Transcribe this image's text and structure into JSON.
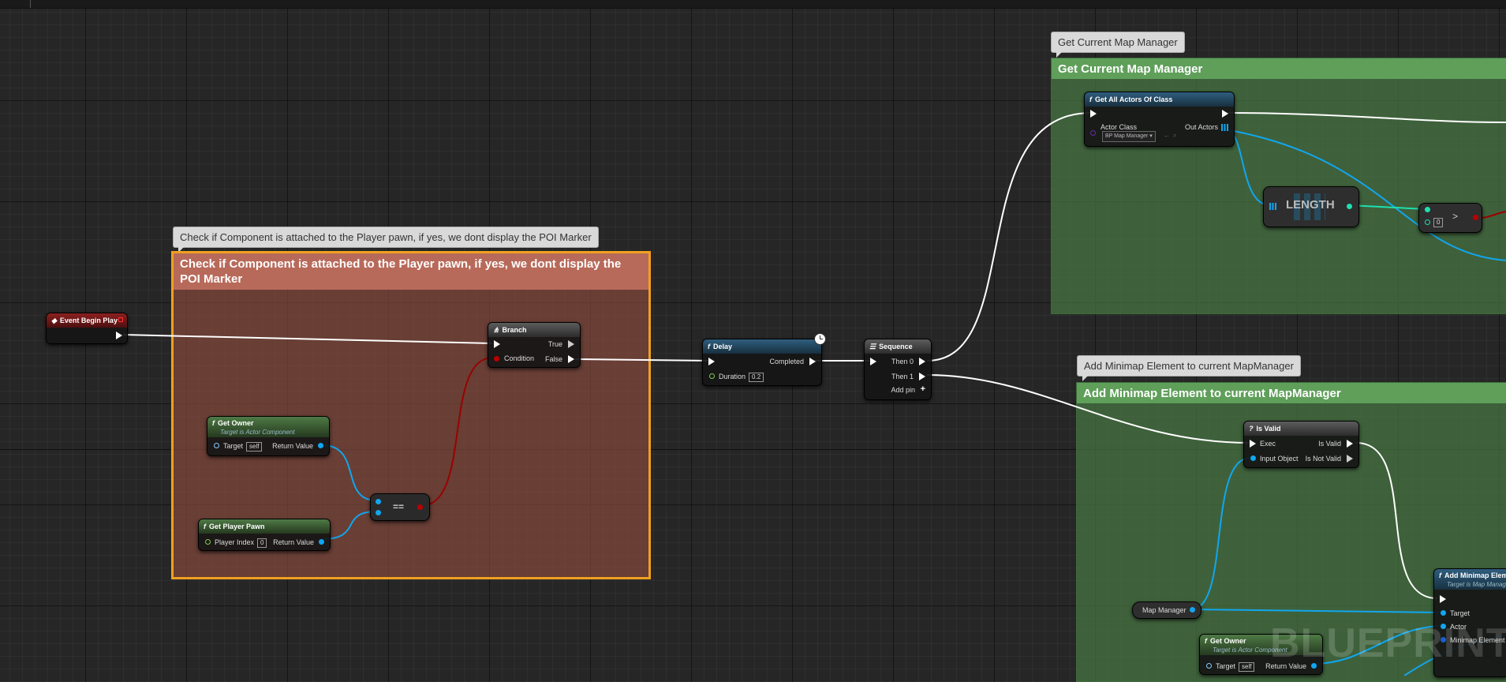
{
  "comments": {
    "check_component": {
      "bubble": "Check if Component is attached to the Player pawn, if yes, we dont display the POI Marker",
      "header": "Check if Component is attached to the Player pawn, if yes, we dont display the POI Marker",
      "color": "#b86a5a"
    },
    "get_map_manager": {
      "bubble": "Get Current Map Manager",
      "header": "Get Current Map Manager",
      "color": "#5f9f5a"
    },
    "add_minimap": {
      "bubble": "Add Minimap Element to current MapManager",
      "header": "Add Minimap Element to current MapManager",
      "color": "#5f9f5a"
    }
  },
  "nodes": {
    "event_begin_play": {
      "title": "Event Begin Play"
    },
    "branch": {
      "title": "Branch",
      "pins": {
        "condition": "Condition",
        "true": "True",
        "false": "False"
      }
    },
    "get_owner_1": {
      "title": "Get Owner",
      "subtitle": "Target is Actor Component",
      "pins": {
        "target": "Target",
        "target_value": "self",
        "return": "Return Value"
      }
    },
    "get_player_pawn": {
      "title": "Get Player Pawn",
      "pins": {
        "player_index": "Player Index",
        "player_index_value": "0",
        "return": "Return Value"
      }
    },
    "equals": {
      "title": "=="
    },
    "delay": {
      "title": "Delay",
      "pins": {
        "completed": "Completed",
        "duration": "Duration",
        "duration_value": "0.2"
      }
    },
    "sequence": {
      "title": "Sequence",
      "pins": {
        "then0": "Then 0",
        "then1": "Then 1",
        "add_pin": "Add pin"
      }
    },
    "get_all_actors": {
      "title": "Get All Actors Of Class",
      "pins": {
        "actor_class": "Actor Class",
        "actor_class_value": "BP Map Manager",
        "out_actors": "Out Actors"
      }
    },
    "length": {
      "title": "LENGTH"
    },
    "compare": {
      "value": "0"
    },
    "is_valid": {
      "title": "Is Valid",
      "pins": {
        "exec": "Exec",
        "input_object": "Input Object",
        "is_valid": "Is Valid",
        "is_not_valid": "Is Not Valid"
      }
    },
    "map_manager": {
      "title": "Map Manager"
    },
    "get_owner_2": {
      "title": "Get Owner",
      "subtitle": "Target is Actor Component",
      "pins": {
        "target": "Target",
        "target_value": "self",
        "return": "Return Value"
      }
    },
    "add_minimap_element": {
      "title": "Add Minimap Element",
      "subtitle": "Target is Map Manager",
      "pins": {
        "target": "Target",
        "actor": "Actor",
        "minimap_element": "Minimap Element"
      }
    }
  },
  "watermark": "BLUEPRINT",
  "colors": {
    "exec_wire": "#ffffff",
    "object_wire": "#11a6ef",
    "bool_wire": "#9b0000",
    "int_wire": "#1ee0b0"
  }
}
